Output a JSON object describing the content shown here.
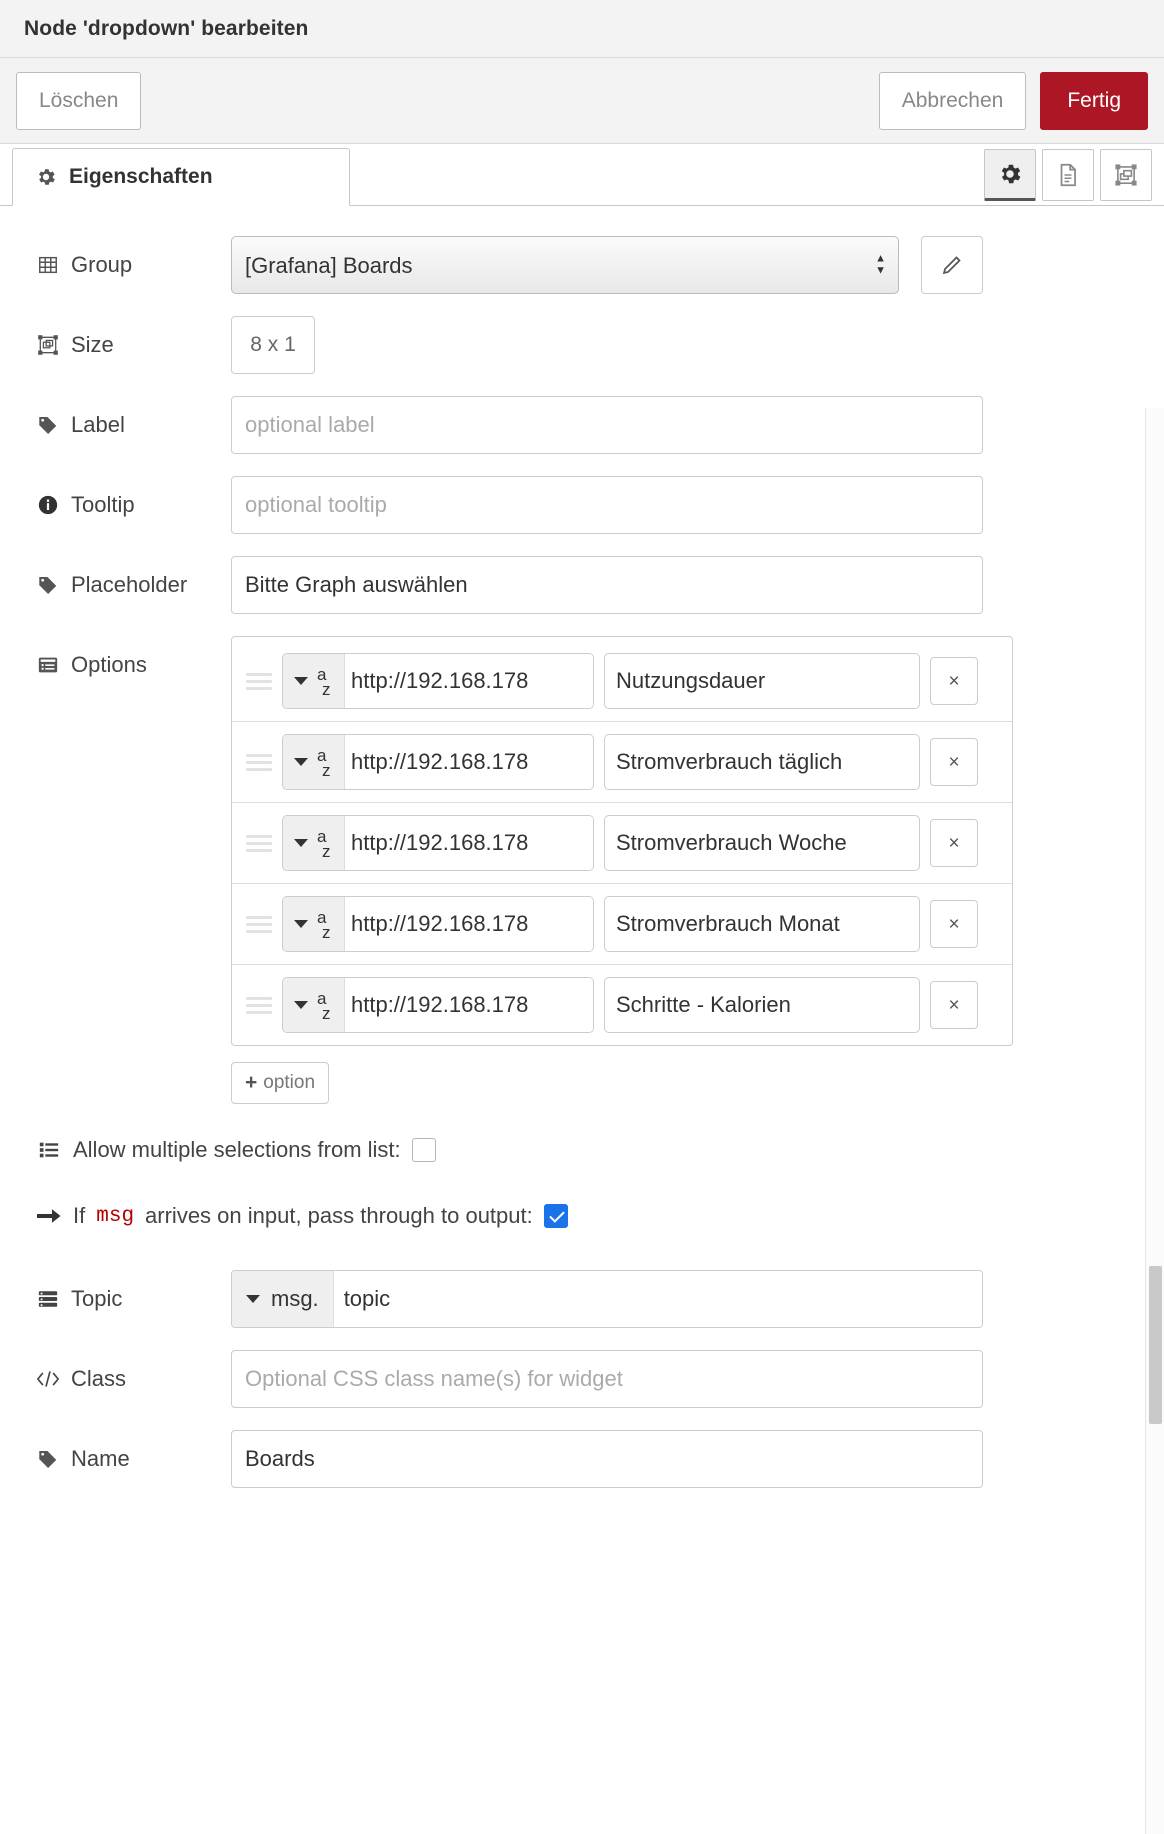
{
  "dialog": {
    "title": "Node 'dropdown' bearbeiten",
    "buttons": {
      "delete": "Löschen",
      "cancel": "Abbrechen",
      "done": "Fertig"
    },
    "tabs": [
      {
        "label": "Eigenschaften",
        "icon": "gear-icon",
        "active": true
      }
    ],
    "tab_tools": [
      {
        "name": "properties-tool",
        "icon": "gear-icon",
        "active": true
      },
      {
        "name": "description-tool",
        "icon": "document-icon",
        "active": false
      },
      {
        "name": "appearance-tool",
        "icon": "layout-icon",
        "active": false
      }
    ]
  },
  "form": {
    "group": {
      "label": "Group",
      "icon": "table-icon",
      "value": "[Grafana] Boards",
      "edit_button_icon": "pencil-icon"
    },
    "size": {
      "label": "Size",
      "icon": "resize-icon",
      "value": "8 x 1"
    },
    "label_field": {
      "label": "Label",
      "icon": "tag-icon",
      "value": "",
      "placeholder": "optional label"
    },
    "tooltip": {
      "label": "Tooltip",
      "icon": "info-icon",
      "value": "",
      "placeholder": "optional tooltip"
    },
    "placeholder_field": {
      "label": "Placeholder",
      "icon": "tag-icon",
      "value": "Bitte Graph auswählen",
      "placeholder": ""
    },
    "options": {
      "label": "Options",
      "icon": "list-alt-icon",
      "type_selector_icon": "az-sort-icon",
      "remove_icon": "×",
      "add_button": "option",
      "add_button_icon": "plus-icon",
      "rows": [
        {
          "value": "http://192.168.178",
          "label": "Nutzungsdauer"
        },
        {
          "value": "http://192.168.178",
          "label": "Stromverbrauch täglich"
        },
        {
          "value": "http://192.168.178",
          "label": "Stromverbrauch Woche"
        },
        {
          "value": "http://192.168.178",
          "label": "Stromverbrauch Monat"
        },
        {
          "value": "http://192.168.178",
          "label": "Schritte - Kalorien"
        }
      ]
    },
    "multiple": {
      "label": "Allow multiple selections from list:",
      "icon": "list-icon",
      "checked": false
    },
    "passthrough": {
      "prefix": "If",
      "code": "msg",
      "suffix": "arrives on input, pass through to output:",
      "icon": "arrow-right-icon",
      "checked": true
    },
    "topic": {
      "label": "Topic",
      "icon": "server-icon",
      "type_prefix": "msg.",
      "value": "topic",
      "placeholder": ""
    },
    "class": {
      "label": "Class",
      "icon": "code-icon",
      "value": "",
      "placeholder": "Optional CSS class name(s) for widget"
    },
    "name": {
      "label": "Name",
      "icon": "tag-icon",
      "value": "Boards",
      "placeholder": ""
    }
  },
  "colors": {
    "primary": "#ad1625",
    "checkbox_checked": "#1a73e8",
    "code_red": "#b30000",
    "panel_bg": "#f3f3f3"
  }
}
